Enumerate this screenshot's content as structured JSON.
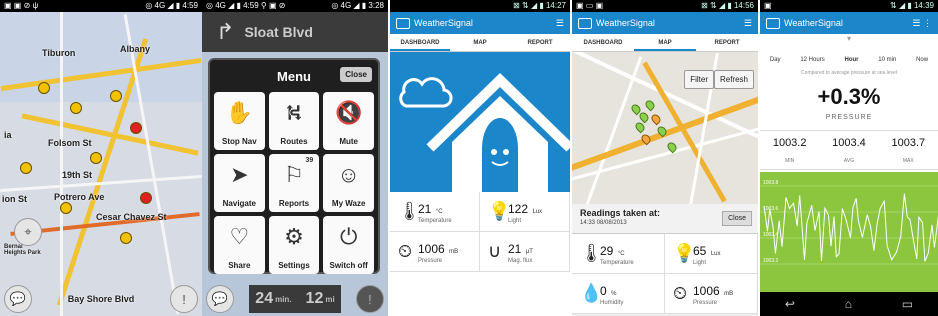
{
  "waze": {
    "statusbar": {
      "left_icons": "▣ ▣ ⊘ ψ",
      "right": "◎ 4G ◢ ▮ 4:59"
    },
    "map_labels": [
      "Tiburon",
      "Albany",
      "Folsom St",
      "Mission St",
      "Potrero Ave",
      "Cesar Chavez St",
      "Bernal Heights Park",
      "ia",
      "19th St",
      "ion St",
      "Bay Shore Blvd"
    ]
  },
  "waze_menu": {
    "statusbar": {
      "left_icons": "◎ 4G ◢ ▮ 4:59 ⚲ ▣ ⊘",
      "right": "◎ 4G ◢ ▮ 3:28"
    },
    "street": "Sloat Blvd",
    "title": "Menu",
    "close": "Close",
    "items": [
      {
        "label": "Stop Nav",
        "icon": "hand-stop-icon",
        "glyph": "✋"
      },
      {
        "label": "Routes",
        "icon": "routes-icon",
        "glyph": "⛕"
      },
      {
        "label": "Mute",
        "icon": "mute-icon",
        "glyph": "🔇"
      },
      {
        "label": "Navigate",
        "icon": "navigate-icon",
        "glyph": "➤"
      },
      {
        "label": "Reports",
        "icon": "reports-icon",
        "glyph": "⚐",
        "badge": "39"
      },
      {
        "label": "My Waze",
        "icon": "my-waze-icon",
        "glyph": "☺"
      },
      {
        "label": "Share",
        "icon": "share-icon",
        "glyph": "♡"
      },
      {
        "label": "Settings",
        "icon": "settings-icon",
        "glyph": "⚙"
      },
      {
        "label": "Switch off",
        "icon": "power-icon",
        "glyph": "⏻"
      }
    ],
    "eta": {
      "time": "24",
      "time_unit": "min.",
      "dist": "12",
      "dist_unit": "mi"
    }
  },
  "weather_dashboard": {
    "statusbar": {
      "right": "⊠ ⇅ ◢ ▮ 14:27"
    },
    "app_title": "WeatherSignal",
    "tabs": [
      "DASHBOARD",
      "MAP",
      "REPORT"
    ],
    "readings": [
      {
        "icon": "thermometer-icon",
        "glyph": "🌡",
        "value": "21",
        "unit": "°C",
        "name": "Temperature"
      },
      {
        "icon": "bulb-icon",
        "glyph": "💡",
        "value": "122",
        "unit": "Lux",
        "name": "Light"
      },
      {
        "icon": "pressure-icon",
        "glyph": "⏲",
        "value": "1006",
        "unit": "mB",
        "name": "Pressure"
      },
      {
        "icon": "magnet-icon",
        "glyph": "∪",
        "value": "21",
        "unit": "μT",
        "name": "Mag. flux"
      }
    ]
  },
  "weather_map": {
    "statusbar": {
      "left": "▣ ▭ ▣",
      "right": "⊠ ⇅ ◢ ▮ 14:56"
    },
    "app_title": "WeatherSignal",
    "tabs": [
      "DASHBOARD",
      "MAP",
      "REPORT"
    ],
    "filter": "Filter",
    "refresh": "Refresh",
    "readings_title": "Readings taken at:",
    "readings_time": "14:33 08/08/2013",
    "close": "Close",
    "readings": [
      {
        "icon": "thermometer-icon",
        "glyph": "🌡",
        "value": "29",
        "unit": "°C",
        "name": "Temperature"
      },
      {
        "icon": "bulb-icon",
        "glyph": "💡",
        "value": "65",
        "unit": "Lux",
        "name": "Light"
      },
      {
        "icon": "humidity-icon",
        "glyph": "💧",
        "value": "0",
        "unit": "%",
        "name": "Humidity"
      },
      {
        "icon": "pressure-icon",
        "glyph": "⏲",
        "value": "1006",
        "unit": "mB",
        "name": "Pressure"
      }
    ]
  },
  "weather_pressure": {
    "statusbar": {
      "left": "▣",
      "right": "⇅ ◢ ▮ 14:39"
    },
    "app_title": "WeatherSignal",
    "ranges": [
      "Day",
      "12 Hours",
      "Hour",
      "10 min",
      "Now"
    ],
    "active_range": "Hour",
    "compare_note": "Compared to average pressure at sea level",
    "change": "+0.3%",
    "label": "PRESSURE",
    "stats": [
      {
        "value": "1003.2",
        "label": "MIN"
      },
      {
        "value": "1003.4",
        "label": "AVG"
      },
      {
        "value": "1003.7",
        "label": "MAX"
      }
    ],
    "chart_ticks": [
      "1003.8",
      "1003.6",
      "1003.4",
      "1003.2"
    ]
  }
}
